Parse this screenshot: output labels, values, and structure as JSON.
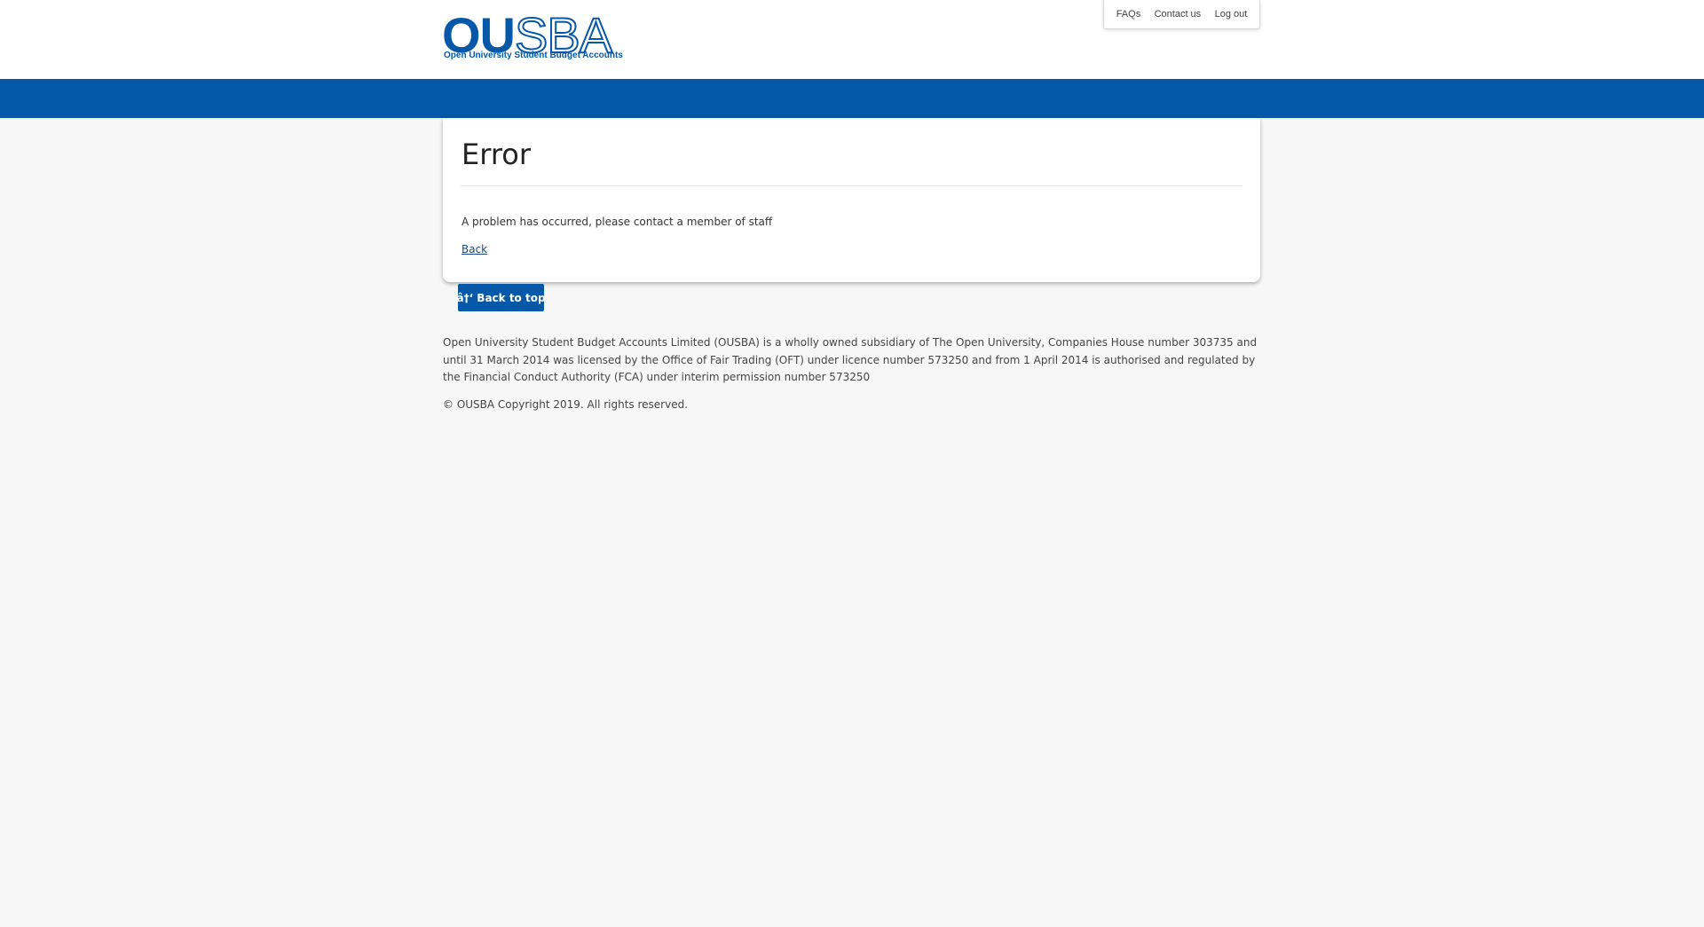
{
  "logo": {
    "main_solid": "OU",
    "main_outline": "SBA",
    "subtitle": "Open University Student Budget Accounts"
  },
  "topnav": {
    "items": [
      "FAQs",
      "Contact us",
      "Log out"
    ]
  },
  "card": {
    "title": "Error",
    "message": "A problem has occurred, please contact a member of staff",
    "back_link": "Back"
  },
  "back_to_top": "â†‘ Back to top",
  "footer": {
    "legal": "Open University Student Budget Accounts Limited (OUSBA) is a wholly owned subsidiary of The Open University, Companies House number 303735 and until 31 March 2014 was licensed by the Office of Fair Trading (OFT) under licence number 573250 and from 1 April 2014 is authorised and regulated by the Financial Conduct Authority (FCA) under interim permission number 573250",
    "copyright": "© OUSBA Copyright 2019. All rights reserved."
  },
  "colors": {
    "brand_blue": "#0558a8",
    "page_background": "#f7f7f7"
  }
}
